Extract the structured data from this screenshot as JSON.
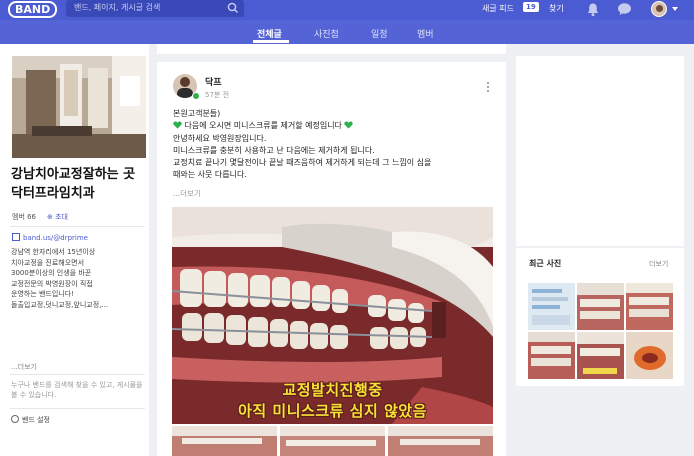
{
  "topbar": {
    "logo": "BAND",
    "search_placeholder": "밴드, 페이지, 게시글 검색",
    "new_feed_label": "새글 피드",
    "new_feed_count": "19",
    "find_label": "찾기"
  },
  "tabs": [
    "전체글",
    "사진첩",
    "일정",
    "멤버"
  ],
  "sidebar": {
    "band_name": "강남치아교정잘하는 곳 닥터프라임치과",
    "members": "멤버 66",
    "invite": "⊕ 초대",
    "link": "band.us/@drprime",
    "description": [
      "강남역 한자리에서 15년이상",
      "치아교정을 진료해오면서",
      "3000분이상의 인생을 바꾼",
      "교정전문의 박영원장이 직접",
      "운영하는 밴드입니다!",
      "돌출입교정,덧니교정,앞니교정,..."
    ],
    "more": "...더보기",
    "notice": "누구나 밴드를 검색해 찾을 수 있고, 게시물을 볼 수 있습니다.",
    "settings": "밴드 설정"
  },
  "post": {
    "author": "닥프",
    "time": "57분 전",
    "lines": [
      "본원고객분들)",
      "다음에 오시면 미니스크류를 제거할 예정입니다",
      "안녕하세요 박영원장입니다.",
      "미니스크류를 충분히 사용하고 난 다음에는 제거하게 됩니다.",
      "교정치료 끝나기 몇달전이나 끝날 때즈음하여 제거하게 되는데 그 느낌이 심을",
      "때와는 사뭇 다릅니다."
    ],
    "more": "...더보기",
    "caption_line1": "교정발치진행중",
    "caption_line2": "아직 미니스크류 심지 않았음"
  },
  "recent_photos": {
    "title": "최근 사진",
    "more": "더보기"
  },
  "colors": {
    "brand": "#4b5bd1",
    "tab_bar": "#5463d6",
    "heart": "#2bb24c",
    "caption": "#f6e236"
  }
}
